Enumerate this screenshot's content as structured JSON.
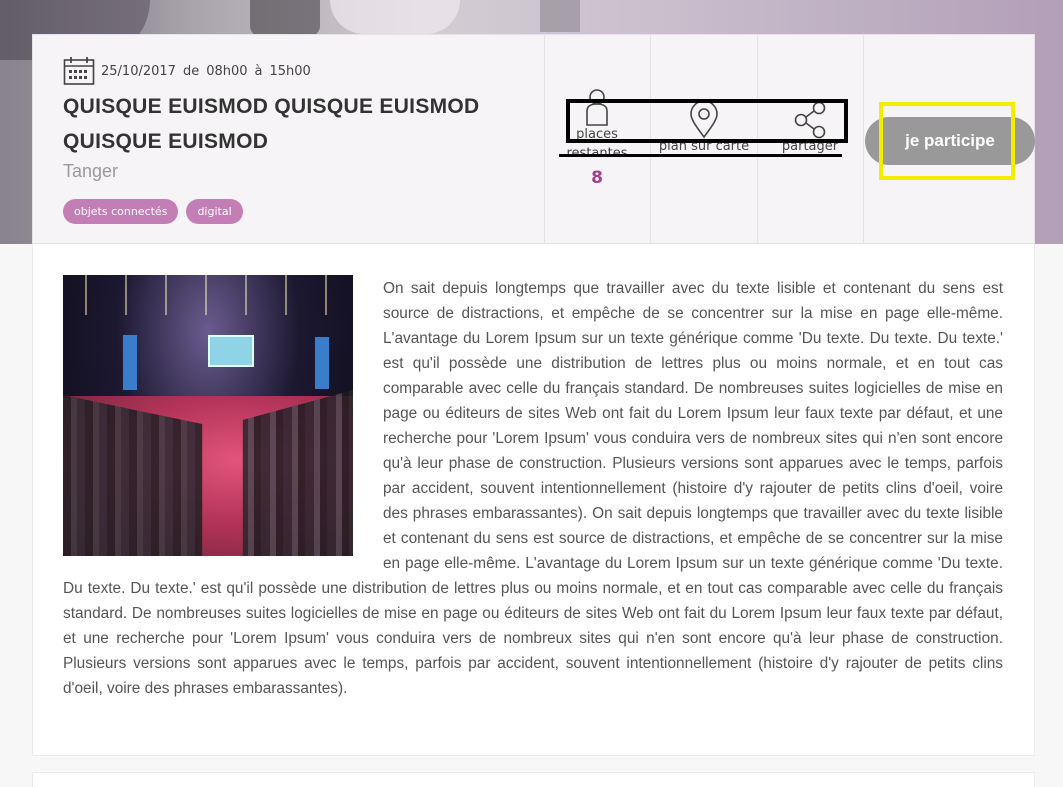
{
  "event": {
    "date": "25/10/2017",
    "from_word": "de",
    "start_time": "08h00",
    "to_word": "à",
    "end_time": "15h00",
    "title_line1": "QUISQUE EUISMOD QUISQUE EUISMOD",
    "title_line2": "QUISQUE EUISMOD",
    "city": "Tanger",
    "tags": [
      "objets connectés",
      "digital"
    ]
  },
  "stats": {
    "places": {
      "label_line1": "places",
      "label_line2": "restantes",
      "value": "8",
      "icon": "person-icon"
    },
    "map": {
      "label": "plan sur carte",
      "icon": "map-pin-icon"
    },
    "share": {
      "label": "partager",
      "icon": "share-icon"
    }
  },
  "actions": {
    "participate_label": "je participe"
  },
  "content": {
    "description": "On sait depuis longtemps que travailler avec du texte lisible et contenant du sens est source de distractions, et empêche de se concentrer sur la mise en page elle-même. L'avantage du Lorem Ipsum sur un texte générique comme 'Du texte. Du texte. Du texte.' est qu'il possède une distribution de lettres plus ou moins normale, et en tout cas comparable avec celle du français standard. De nombreuses suites logicielles de mise en page ou éditeurs de sites Web ont fait du Lorem Ipsum leur faux texte par défaut, et une recherche pour 'Lorem Ipsum' vous conduira vers de nombreux sites qui n'en sont encore qu'à leur phase de construction. Plusieurs versions sont apparues avec le temps, parfois par accident, souvent intentionnellement (histoire d'y rajouter de petits clins d'oeil, voire des phrases embarassantes). On sait depuis longtemps que travailler avec du texte lisible et contenant du sens est source de distractions, et empêche de se concentrer sur la mise en page elle-même. L'avantage du Lorem Ipsum sur un texte générique comme 'Du texte. Du texte. Du texte.' est qu'il possède une distribution de lettres plus ou moins normale, et en tout cas comparable avec celle du français standard. De nombreuses suites logicielles de mise en page ou éditeurs de sites Web ont fait du Lorem Ipsum leur faux texte par défaut, et une recherche pour 'Lorem Ipsum' vous conduira vers de nombreux sites qui n'en sont encore qu'à leur phase de construction. Plusieurs versions sont apparues avec le temps, parfois par accident, souvent intentionnellement (histoire d'y rajouter de petits clins d'oeil, voire des phrases embarassantes)."
  },
  "colors": {
    "accent": "#a33e8d",
    "tag_bg": "#c47eb6",
    "button_bg": "#999999",
    "annotation_yellow": "#f5ed00"
  }
}
